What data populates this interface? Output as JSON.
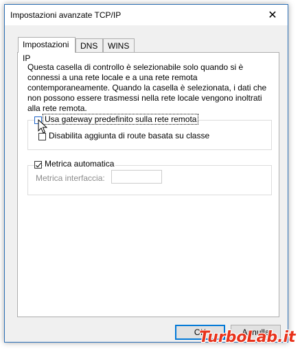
{
  "window": {
    "title": "Impostazioni avanzate TCP/IP",
    "close_glyph": "✕"
  },
  "tabs": [
    {
      "label": "Impostazioni IP",
      "active": true
    },
    {
      "label": "DNS",
      "active": false
    },
    {
      "label": "WINS",
      "active": false
    }
  ],
  "panel": {
    "description": "Questa casella di controllo è selezionabile solo quando si è connessi a una rete locale e a una rete remota contemporaneamente. Quando la casella è selezionata, i dati che non possono essere trasmessi nella rete locale vengono inoltrati alla rete remota.",
    "gateway_checkbox": {
      "label": "Usa gateway predefinito sulla rete remota",
      "checked": false
    },
    "class_route_checkbox": {
      "label": "Disabilita aggiunta di route basata su classe",
      "checked": false
    },
    "auto_metric_checkbox": {
      "label": "Metrica automatica",
      "checked": true
    },
    "interface_metric": {
      "label": "Metrica interfaccia:",
      "value": ""
    }
  },
  "buttons": {
    "ok": "OK",
    "cancel": "Annulla"
  },
  "watermark": {
    "text": "TurboLab.it"
  },
  "icons": {
    "close": "close-icon",
    "cursor": "mouse-pointer-icon"
  }
}
